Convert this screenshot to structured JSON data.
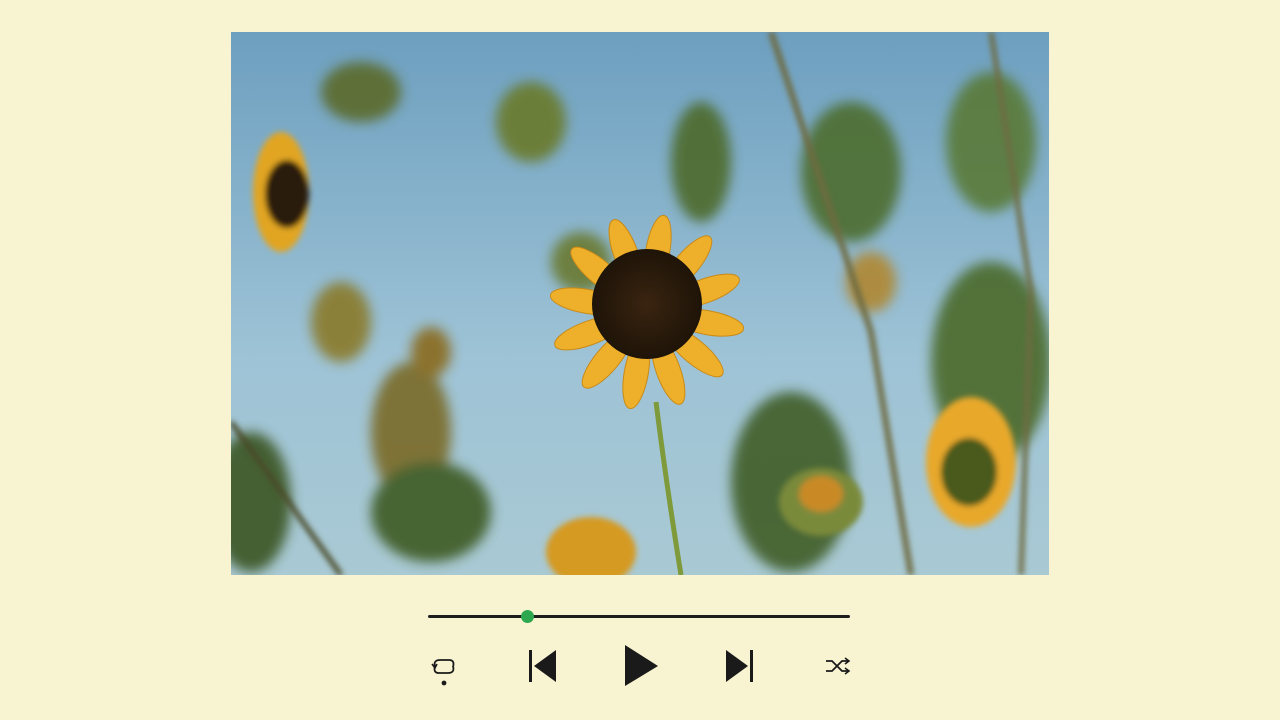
{
  "player": {
    "artwork": {
      "description_icon": "sunflower-artwork-image"
    },
    "progress": {
      "fraction": 0.235,
      "played_color": "#2ea84f",
      "track_color": "#1d1d1d"
    },
    "controls": {
      "repeat_icon": "repeat-one-icon",
      "previous_icon": "skip-previous-icon",
      "play_icon": "play-icon",
      "next_icon": "skip-next-icon",
      "shuffle_icon": "shuffle-icon"
    },
    "colors": {
      "background": "#f8f4d2",
      "icon": "#1a1a1a"
    }
  }
}
